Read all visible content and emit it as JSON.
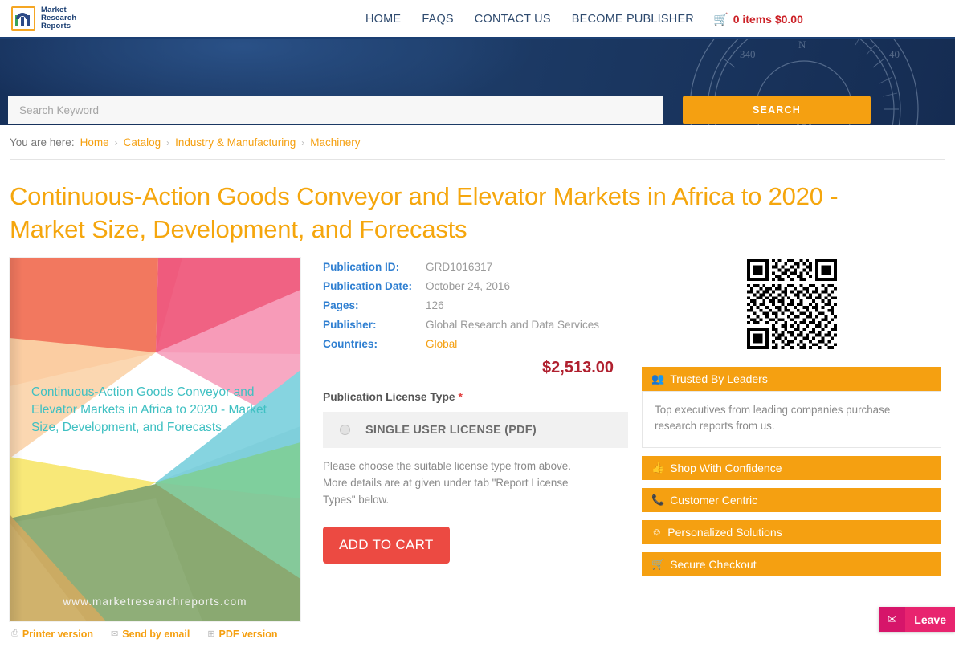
{
  "header": {
    "logo": {
      "line1": "Market",
      "line2": "Research",
      "line3": "Reports",
      "reg": "®"
    },
    "nav": [
      {
        "label": "HOME"
      },
      {
        "label": "FAQS"
      },
      {
        "label": "CONTACT US"
      },
      {
        "label": "BECOME PUBLISHER"
      }
    ],
    "cart": {
      "icon": "shopping-cart-icon",
      "text": "0 items $0.00"
    }
  },
  "search": {
    "placeholder": "Search Keyword",
    "value": "",
    "button_label": "SEARCH"
  },
  "breadcrumb": {
    "prefix": "You are here:",
    "items": [
      {
        "label": "Home"
      },
      {
        "label": "Catalog"
      },
      {
        "label": "Industry & Manufacturing"
      },
      {
        "label": "Machinery"
      }
    ],
    "separator": "›"
  },
  "page": {
    "title": "Continuous-Action Goods Conveyor and Elevator Markets in Africa to 2020 - Market Size, Development, and Forecasts"
  },
  "cover": {
    "title": "Continuous-Action Goods Conveyor and Elevator Markets in Africa to 2020 - Market Size, Development, and Forecasts",
    "url": "www.marketresearchreports.com",
    "links": [
      {
        "label": "Printer version",
        "icon": "printer-icon"
      },
      {
        "label": "Send by email",
        "icon": "envelope-icon"
      },
      {
        "label": "PDF version",
        "icon": "pdf-icon"
      }
    ]
  },
  "details": {
    "rows": [
      {
        "key": "Publication ID:",
        "value": "GRD1016317",
        "highlight": false
      },
      {
        "key": "Publication Date:",
        "value": "October 24, 2016",
        "highlight": false
      },
      {
        "key": "Pages:",
        "value": "126",
        "highlight": false
      },
      {
        "key": "Publisher:",
        "value": "Global Research and Data Services",
        "highlight": false
      },
      {
        "key": "Countries:",
        "value": "Global",
        "highlight": true
      }
    ],
    "price": "$2,513.00"
  },
  "license": {
    "label": "Publication License Type",
    "required_mark": "*",
    "option": "SINGLE USER LICENSE (PDF)",
    "selected": false,
    "note": "Please choose the suitable license type from above. More details are at given under tab \"Report License Types\" below.",
    "add_to_cart_label": "ADD TO CART"
  },
  "sidebar": {
    "qr_alt": "qr-code",
    "panels": [
      {
        "title": "Trusted By Leaders",
        "icon": "users-group-icon",
        "body": "Top executives from leading companies purchase research reports from us.",
        "expanded": true
      },
      {
        "title": "Shop With Confidence",
        "icon": "thumbs-up-icon",
        "body": "",
        "expanded": false
      },
      {
        "title": "Customer Centric",
        "icon": "phone-icon",
        "body": "",
        "expanded": false
      },
      {
        "title": "Personalized Solutions",
        "icon": "smiley-icon",
        "body": "",
        "expanded": false
      },
      {
        "title": "Secure Checkout",
        "icon": "shopping-cart-icon",
        "body": "",
        "expanded": false
      }
    ]
  },
  "chat_widget": {
    "icon": "envelope-icon",
    "label": "Leave"
  },
  "colors": {
    "brand_orange": "#f5a011",
    "navy": "#16305a",
    "cart_red": "#cc2127",
    "price_red": "#b0202f",
    "add_cart_red": "#ec4a42",
    "link_blue": "#2f7fd1",
    "chat_pink": "#e8246f"
  }
}
